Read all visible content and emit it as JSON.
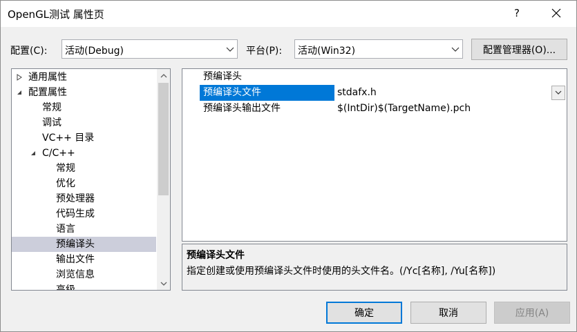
{
  "window": {
    "title": "OpenGL测试 属性页",
    "help_glyph": "?",
    "close_icon": "close-icon"
  },
  "config_bar": {
    "config_label": "配置(C):",
    "config_value": "活动(Debug)",
    "platform_label": "平台(P):",
    "platform_value": "活动(Win32)",
    "manager_button": "配置管理器(O)..."
  },
  "tree": {
    "items": [
      {
        "label": "通用属性",
        "level": 0,
        "toggle": "collapsed"
      },
      {
        "label": "配置属性",
        "level": 0,
        "toggle": "expanded"
      },
      {
        "label": "常规",
        "level": 1,
        "toggle": "none"
      },
      {
        "label": "调试",
        "level": 1,
        "toggle": "none"
      },
      {
        "label": "VC++ 目录",
        "level": 1,
        "toggle": "none"
      },
      {
        "label": "C/C++",
        "level": 1,
        "toggle": "expanded"
      },
      {
        "label": "常规",
        "level": 2,
        "toggle": "none"
      },
      {
        "label": "优化",
        "level": 2,
        "toggle": "none"
      },
      {
        "label": "预处理器",
        "level": 2,
        "toggle": "none"
      },
      {
        "label": "代码生成",
        "level": 2,
        "toggle": "none"
      },
      {
        "label": "语言",
        "level": 2,
        "toggle": "none"
      },
      {
        "label": "预编译头",
        "level": 2,
        "toggle": "none",
        "selected": true
      },
      {
        "label": "输出文件",
        "level": 2,
        "toggle": "none"
      },
      {
        "label": "浏览信息",
        "level": 2,
        "toggle": "none"
      },
      {
        "label": "高级",
        "level": 2,
        "toggle": "none"
      }
    ]
  },
  "properties": {
    "rows": [
      {
        "name": "预编译头",
        "value": ""
      },
      {
        "name": "预编译头文件",
        "value": "stdafx.h",
        "selected": true
      },
      {
        "name": "预编译头输出文件",
        "value": "$(IntDir)$(TargetName).pch"
      }
    ]
  },
  "description": {
    "title": "预编译头文件",
    "text": "指定创建或使用预编译头文件时使用的头文件名。(/Yc[名称], /Yu[名称])"
  },
  "buttons": {
    "ok": "确定",
    "cancel": "取消",
    "apply": "应用(A)"
  },
  "colors": {
    "selection_accent": "#0078d7",
    "tree_selection": "#cccedb"
  }
}
